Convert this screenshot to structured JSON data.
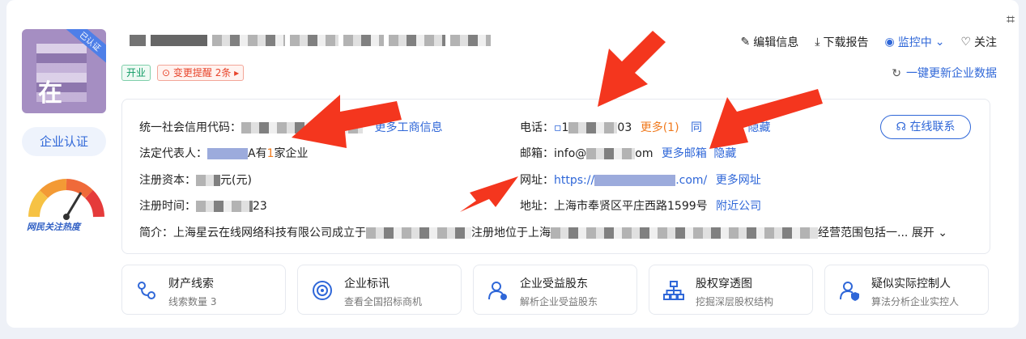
{
  "logo": {
    "char": "在",
    "tag": "已认证"
  },
  "certify_label": "企业认证",
  "heat_label": "网民关注热度",
  "badges": {
    "status": "开业",
    "change_alert": "变更提醒 2条"
  },
  "actions": {
    "edit": "编辑信息",
    "download": "下载报告",
    "monitor": "监控中",
    "follow": "关注"
  },
  "refresh": "一键更新企业数据",
  "info": {
    "credit_code_label": "统一社会信用代码：",
    "more_business": "更多工商信息",
    "legal_label": "法定代表人：",
    "legal_suffix": "A有",
    "legal_count": "1",
    "legal_tail": "家企业",
    "capital_label": "注册资本：",
    "capital_suffix": "元(元)",
    "date_label": "注册时间：",
    "date_suffix": "23",
    "intro_label": "简介：",
    "intro_text": "上海星云在线网络科技有限公司成立于",
    "intro_mid": "注册地位于上海",
    "intro_tail": "经营范围包括一...",
    "expand": "展开",
    "phone_label": "电话：",
    "phone_prefix": "1",
    "phone_suffix": "03",
    "more_phone": "更多(1)",
    "same_phone": "同",
    "hide": "隐藏",
    "email_label": "邮箱：",
    "email_prefix": "info@",
    "email_suffix": "om",
    "more_email": "更多邮箱",
    "email_hide": "隐藏",
    "url_label": "网址：",
    "url_prefix": "https://",
    "url_suffix": ".com/",
    "more_url": "更多网址",
    "address_label": "地址：",
    "address": "上海市奉贤区平庄西路1599号",
    "nearby": "附近公司",
    "online_contact": "在线联系"
  },
  "features": [
    {
      "title": "财产线索",
      "sub": "线索数量 3",
      "icon": "clue-icon"
    },
    {
      "title": "企业标讯",
      "sub": "查看全国招标商机",
      "icon": "target-icon"
    },
    {
      "title": "企业受益股东",
      "sub": "解析企业受益股东",
      "icon": "shareholder-icon"
    },
    {
      "title": "股权穿透图",
      "sub": "挖掘深层股权结构",
      "icon": "org-chart-icon"
    },
    {
      "title": "疑似实际控制人",
      "sub": "算法分析企业实控人",
      "icon": "controller-icon"
    }
  ],
  "colors": {
    "accent": "#2f67d8",
    "arrow": "#f4361e",
    "logo_bg": "#a58ec2"
  }
}
